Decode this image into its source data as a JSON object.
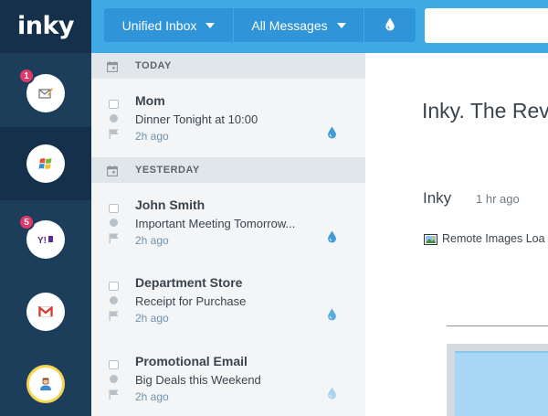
{
  "app": {
    "logo": "inky"
  },
  "accounts": [
    {
      "name": "account-inbox",
      "badge": "1"
    },
    {
      "name": "account-windows",
      "badge": ""
    },
    {
      "name": "account-yahoo",
      "badge": "5"
    },
    {
      "name": "account-gmail",
      "badge": ""
    },
    {
      "name": "account-profile",
      "badge": ""
    }
  ],
  "toolbar": {
    "unified_inbox_label": "Unified Inbox",
    "all_messages_label": "All Messages",
    "search_placeholder": ""
  },
  "message_list": {
    "sections": [
      {
        "label": "TODAY"
      },
      {
        "label": "YESTERDAY"
      }
    ],
    "messages": [
      {
        "sender": "Mom",
        "subject": "Dinner Tonight at 10:00",
        "time": "2h ago"
      },
      {
        "sender": "John Smith",
        "subject": "Important Meeting Tomorrow...",
        "time": "2h ago"
      },
      {
        "sender": "Department Store",
        "subject": "Receipt for Purchase",
        "time": "2h ago"
      },
      {
        "sender": "Promotional Email",
        "subject": "Big Deals this Weekend",
        "time": "2h ago"
      }
    ]
  },
  "reading_pane": {
    "title": "Inky. The Rev",
    "from": "Inky",
    "time": "1 hr ago",
    "remote_images": "Remote Images Loa"
  },
  "colors": {
    "sidebar": "#1d3e5a",
    "toolbar": "#3fa9e6",
    "badge": "#e0386a",
    "accent": "#3f9ad6"
  }
}
